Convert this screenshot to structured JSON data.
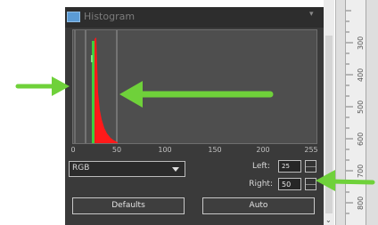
{
  "panel": {
    "title": "Histogram",
    "menu_glyph": "▾"
  },
  "histogram": {
    "x_ticks": [
      "0",
      "50",
      "100",
      "150",
      "200",
      "255"
    ],
    "left_value": 25,
    "right_value": 50,
    "max_value": 255
  },
  "channel_select": {
    "value": "RGB"
  },
  "fields": {
    "left_label": "Left:",
    "left_value": "25",
    "right_label": "Right:",
    "right_value": "50"
  },
  "buttons": {
    "defaults": "Defaults",
    "auto": "Auto"
  },
  "ruler": {
    "labels": [
      "300",
      "400",
      "500",
      "600",
      "700",
      "800"
    ]
  },
  "scrollbar": {
    "down_arrow": "⌄"
  },
  "colors": {
    "annotation_arrow": "#6fd13a",
    "histogram_red": "#ff1a1a",
    "histogram_green": "#3ecf3e",
    "marker_line": "#9a9a9a"
  }
}
